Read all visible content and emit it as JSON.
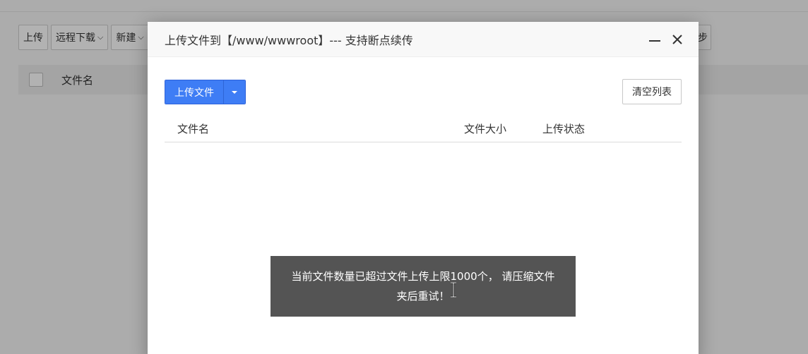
{
  "background": {
    "toolbar": {
      "upload": "上传",
      "remote_download": "远程下载",
      "new": "新建",
      "right_fragment": "步"
    },
    "table": {
      "col_name": "文件名"
    }
  },
  "modal": {
    "title": "上传文件到【/www/wwwroot】--- 支持断点续传",
    "upload_button": "上传文件",
    "clear_button": "清空列表",
    "columns": {
      "name": "文件名",
      "size": "文件大小",
      "status": "上传状态"
    }
  },
  "toast": {
    "message": "当前文件数量已超过文件上传上限1000个， 请压缩文件夹后重试！"
  },
  "colors": {
    "primary": "#3e7df5",
    "toast_bg": "#545454"
  }
}
